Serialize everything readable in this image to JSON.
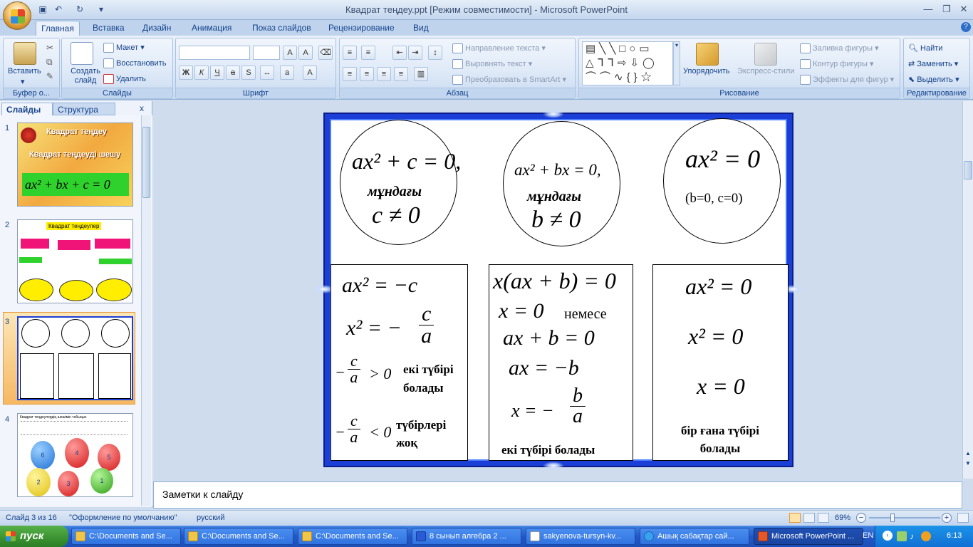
{
  "window": {
    "title": "Квадрат теңдеу.ppt [Режим совместимости] - Microsoft PowerPoint"
  },
  "tabs": [
    "Главная",
    "Вставка",
    "Дизайн",
    "Анимация",
    "Показ слайдов",
    "Рецензирование",
    "Вид"
  ],
  "ribbon": {
    "clipboard": {
      "paste": "Вставить",
      "label": "Буфер о..."
    },
    "slides": {
      "new_slide": "Создать слайд",
      "layout": "Макет",
      "reset": "Восстановить",
      "delete": "Удалить",
      "label": "Слайды"
    },
    "font": {
      "label": "Шрифт"
    },
    "paragraph": {
      "text_direction": "Направление текста",
      "align_text": "Выровнять текст",
      "smartart": "Преобразовать в SmartArt",
      "label": "Абзац"
    },
    "drawing": {
      "arrange": "Упорядочить",
      "quick_styles": "Экспресс-стили",
      "fill": "Заливка фигуры",
      "outline": "Контур фигуры",
      "effects": "Эффекты для фигур",
      "label": "Рисование"
    },
    "editing": {
      "find": "Найти",
      "replace": "Заменить",
      "select": "Выделить",
      "label": "Редактирование"
    }
  },
  "panel": {
    "tab_slides": "Слайды",
    "tab_outline": "Структура",
    "close": "x"
  },
  "thumbs": {
    "numbers": [
      "1",
      "2",
      "3",
      "4"
    ],
    "t1": {
      "title1": "Квадрат теңдеу",
      "title2": "Квадрат теңдеуді шешу",
      "formula": "ax² + bx + c = 0"
    },
    "t2": {
      "title": "Квадрат теңдеулер"
    },
    "t4": {
      "header": "Квадрат теңдеулердің шешімін табыңыз"
    },
    "balloons": [
      "6",
      "4",
      "5",
      "2",
      "3",
      "1"
    ]
  },
  "slide": {
    "c1": {
      "eq": "ax² + c = 0,",
      "word": "мұндағы",
      "cond": "c ≠ 0"
    },
    "c2": {
      "eq": "ax² + bx = 0,",
      "word": "мұндағы",
      "cond": "b ≠ 0"
    },
    "c3": {
      "eq": "ax² = 0",
      "cond": "(b=0, c=0)"
    },
    "b1": {
      "l1": "ax² = −c",
      "l2_left": "x² = −",
      "frac_num": "c",
      "frac_den": "a",
      "pos_num": "c",
      "pos_den": "a",
      "pos_tail": "> 0",
      "pos_text": "екі түбірі болады",
      "neg_num": "c",
      "neg_den": "a",
      "neg_tail": "< 0",
      "neg_text": "түбірлері жоқ",
      "minus": "−"
    },
    "b2": {
      "l1": "x(ax + b) = 0",
      "l2": "x = 0",
      "l2_word": "немесе",
      "l3": "ax + b = 0",
      "l4": "ax = −b",
      "l5": "x = −",
      "l5_num": "b",
      "l5_den": "a",
      "text": "екі түбірі болады"
    },
    "b3": {
      "l1": "ax² = 0",
      "l2": "x² = 0",
      "l3": "x = 0",
      "text": "бір ғана түбірі болады"
    }
  },
  "notes": {
    "placeholder": "Заметки к слайду"
  },
  "status": {
    "slide": "Слайд 3 из 16",
    "theme": "\"Оформление по умолчанию\"",
    "lang": "русский",
    "zoom": "69%"
  },
  "zoom": {
    "level": 0.69
  },
  "taskbar": {
    "start": "пуск",
    "tasks": [
      "C:\\Documents and Se...",
      "C:\\Documents and Se...",
      "C:\\Documents and Se...",
      "8 сынып алгебра  2 ...",
      "sakyenova-tursyn-kv...",
      "Ашық сабақтар сай...",
      "Microsoft PowerPoint ..."
    ],
    "lang": "EN",
    "time": "6:13"
  }
}
